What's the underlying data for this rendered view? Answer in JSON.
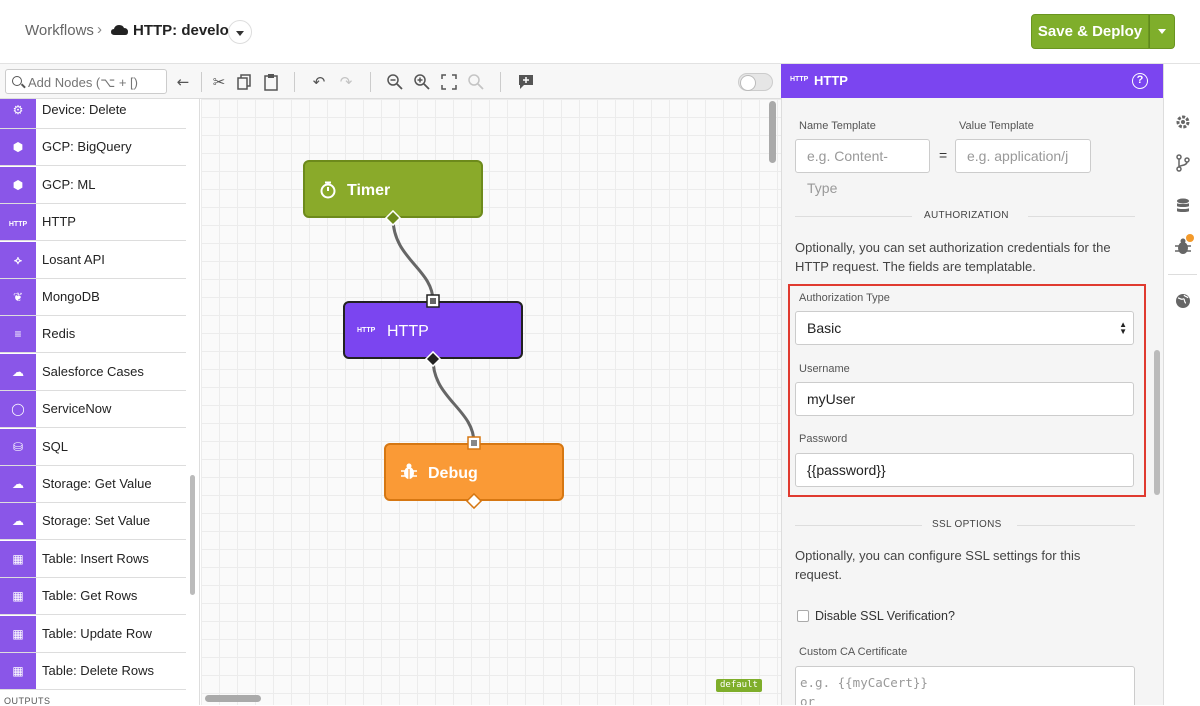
{
  "header": {
    "breadcrumb_root": "Workflows",
    "breadcrumb_sep": "›",
    "workflow_name": "HTTP: develop",
    "deploy_label": "Save & Deploy",
    "deploy_color": "#7fae2b"
  },
  "toolbar": {
    "search_placeholder": "Add Nodes (⌥ + [)",
    "icons": [
      "arrow-left-icon",
      "cut-icon",
      "copy-icon",
      "paste-icon",
      "undo-icon",
      "redo-icon",
      "zoom-out-icon",
      "zoom-in-icon",
      "fit-icon",
      "zoom-reset-icon",
      "add-comment-icon",
      "toggle"
    ]
  },
  "palette": {
    "items": [
      {
        "label": "Device: Delete",
        "icon": "chip-icon"
      },
      {
        "label": "GCP: BigQuery",
        "icon": "hexagon-icon"
      },
      {
        "label": "GCP: ML",
        "icon": "hexagon-icon"
      },
      {
        "label": "HTTP",
        "icon": "http-icon",
        "icon_text": "HTTP"
      },
      {
        "label": "Losant API",
        "icon": "losant-icon"
      },
      {
        "label": "MongoDB",
        "icon": "leaf-icon"
      },
      {
        "label": "Redis",
        "icon": "layers-icon"
      },
      {
        "label": "Salesforce Cases",
        "icon": "cloud-icon"
      },
      {
        "label": "ServiceNow",
        "icon": "circle-icon"
      },
      {
        "label": "SQL",
        "icon": "database-icon"
      },
      {
        "label": "Storage: Get Value",
        "icon": "cloud-download-icon"
      },
      {
        "label": "Storage: Set Value",
        "icon": "cloud-upload-icon"
      },
      {
        "label": "Table: Insert Rows",
        "icon": "table-icon"
      },
      {
        "label": "Table: Get Rows",
        "icon": "table-icon"
      },
      {
        "label": "Table: Update Row",
        "icon": "table-icon"
      },
      {
        "label": "Table: Delete Rows",
        "icon": "table-icon"
      }
    ],
    "section_label": "OUTPUTS",
    "accent": "#8a56e8"
  },
  "canvas": {
    "nodes": [
      {
        "label": "Timer",
        "icon": "stopwatch-icon",
        "color": "#8aaa2a"
      },
      {
        "label": "HTTP",
        "icon": "http-icon",
        "icon_text": "HTTP",
        "color": "#7b45f0"
      },
      {
        "label": "Debug",
        "icon": "bug-icon",
        "color": "#fa9a36"
      }
    ],
    "badge": "default"
  },
  "panel": {
    "title": "HTTP",
    "title_icon_text": "HTTP",
    "header_color": "#7b45f0",
    "name_template_label": "Name Template",
    "value_template_label": "Value Template",
    "name_template_placeholder": "e.g. Content-Type",
    "value_template_placeholder": "e.g. application/j",
    "equals": "=",
    "authorization": {
      "section_title": "AUTHORIZATION",
      "description": "Optionally, you can set authorization credentials for the HTTP request. The fields are templatable.",
      "type_label": "Authorization Type",
      "type_value": "Basic",
      "username_label": "Username",
      "username_value": "myUser",
      "password_label": "Password",
      "password_value": "{{password}}"
    },
    "ssl": {
      "section_title": "SSL OPTIONS",
      "description": "Optionally, you can configure SSL settings for this request.",
      "disable_label": "Disable SSL Verification?",
      "disable_checked": false,
      "ca_label": "Custom CA Certificate",
      "ca_placeholder": "e.g. {{myCaCert}}\nor"
    },
    "highlight_color": "#e03a2f"
  },
  "rail": {
    "icons": [
      "gear-icon",
      "branch-icon",
      "database-icon",
      "bug-icon",
      "globe-icon"
    ]
  }
}
